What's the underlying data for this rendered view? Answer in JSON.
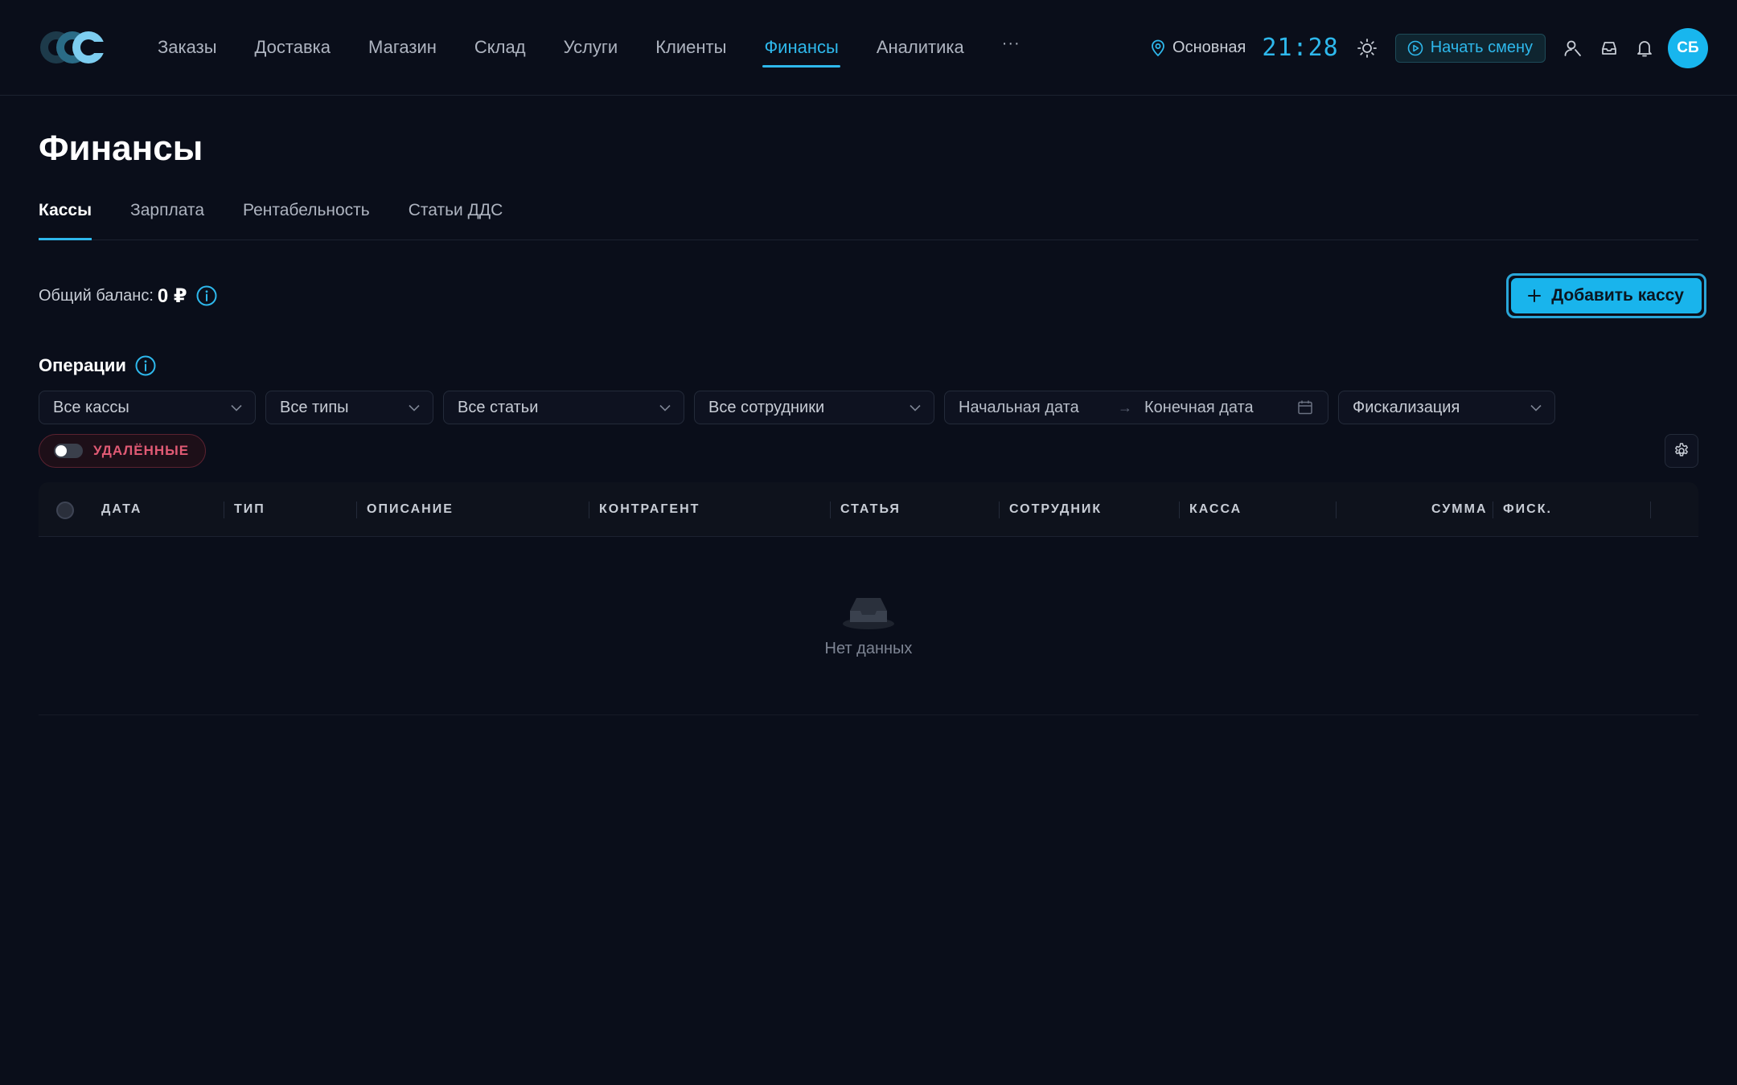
{
  "nav": {
    "items": [
      {
        "label": "Заказы"
      },
      {
        "label": "Доставка"
      },
      {
        "label": "Магазин"
      },
      {
        "label": "Склад"
      },
      {
        "label": "Услуги"
      },
      {
        "label": "Клиенты"
      },
      {
        "label": "Финансы",
        "active": true
      },
      {
        "label": "Аналитика"
      }
    ],
    "more_label": "···"
  },
  "topbar": {
    "location": "Основная",
    "time": "21:28",
    "shift_button": "Начать смену",
    "avatar_initials": "СБ"
  },
  "page": {
    "title": "Финансы",
    "tabs": [
      {
        "label": "Кассы",
        "active": true
      },
      {
        "label": "Зарплата"
      },
      {
        "label": "Рентабельность"
      },
      {
        "label": "Статьи ДДС"
      }
    ]
  },
  "balance": {
    "label": "Общий баланс:",
    "value": "0 ₽"
  },
  "add_button": "Добавить кассу",
  "operations": {
    "title": "Операции",
    "filters": {
      "cash": "Все кассы",
      "types": "Все типы",
      "articles": "Все статьи",
      "employees": "Все сотрудники",
      "start_date": "Начальная дата",
      "end_date": "Конечная дата",
      "fiscal": "Фискализация"
    },
    "deleted_toggle": "УДАЛЁННЫЕ",
    "deleted_on": false
  },
  "table": {
    "columns": [
      "ДАТА",
      "ТИП",
      "ОПИСАНИЕ",
      "КОНТРАГЕНТ",
      "СТАТЬЯ",
      "СОТРУДНИК",
      "КАССА",
      "СУММА",
      "ФИСК."
    ],
    "rows": [],
    "empty_text": "Нет данных"
  },
  "colors": {
    "accent": "#2eb8ec",
    "background": "#0a0e1a",
    "danger": "#e05a74"
  }
}
